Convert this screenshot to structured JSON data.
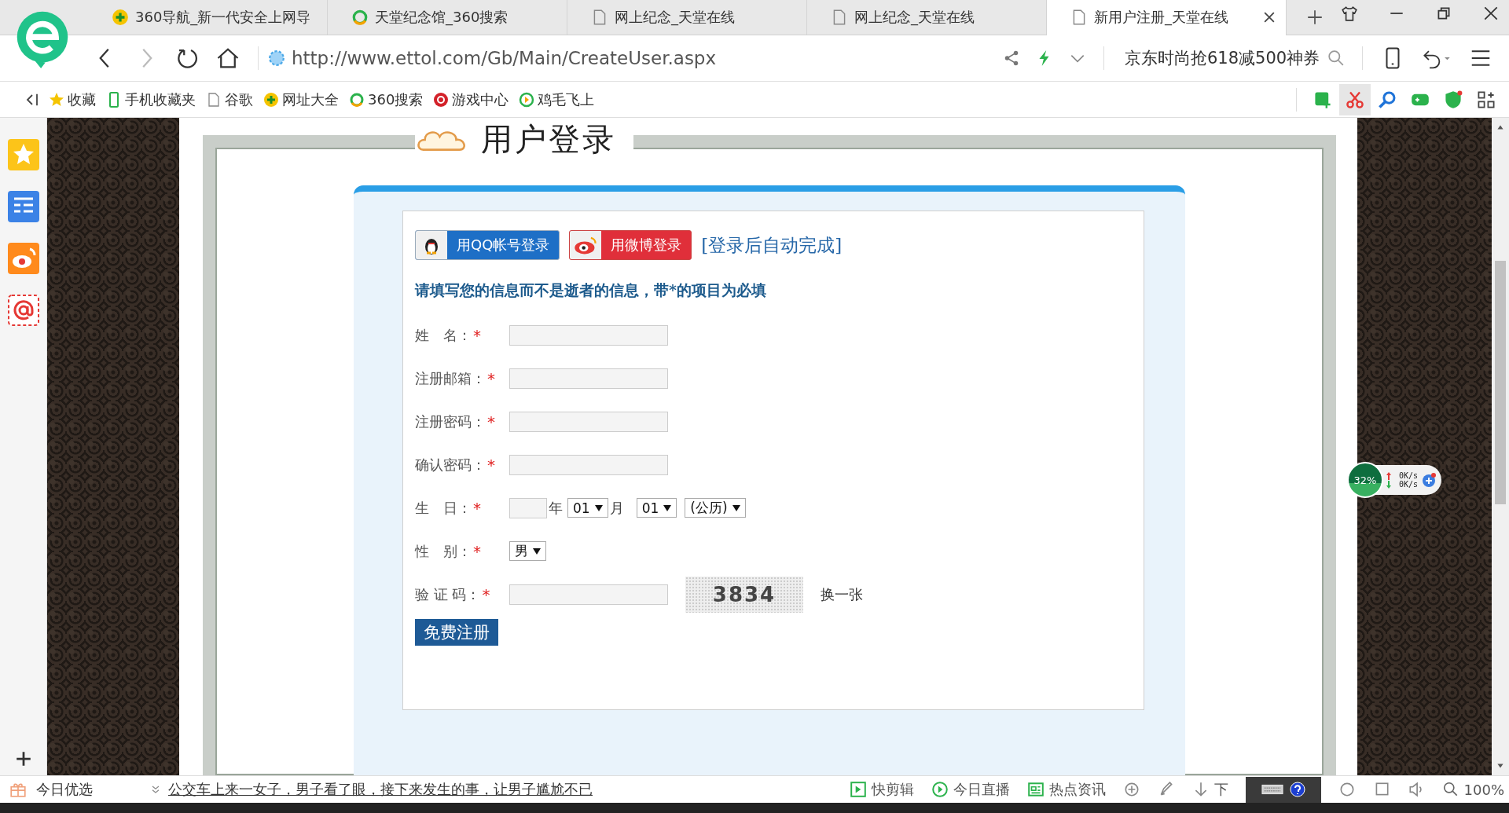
{
  "tabs": [
    {
      "label": "360导航_新一代安全上网导",
      "selected": false
    },
    {
      "label": "天堂纪念馆_360搜索",
      "selected": false
    },
    {
      "label": "网上纪念_天堂在线",
      "selected": false
    },
    {
      "label": "网上纪念_天堂在线",
      "selected": false
    },
    {
      "label": "新用户注册_天堂在线",
      "selected": true
    }
  ],
  "address": {
    "url": "http://www.ettol.com/Gb/Main/CreateUser.aspx",
    "search": "京东时尚抢618减500神券"
  },
  "bookmarks": [
    {
      "label": "收藏"
    },
    {
      "label": "手机收藏夹"
    },
    {
      "label": "谷歌"
    },
    {
      "label": "网址大全"
    },
    {
      "label": "360搜索"
    },
    {
      "label": "游戏中心"
    },
    {
      "label": "鸡毛飞上"
    }
  ],
  "page": {
    "title": "用户登录",
    "qq_login": "用QQ帐号登录",
    "weibo_login": "用微博登录",
    "auto_note": "[登录后自动完成]",
    "notice": "请填写您的信息而不是逝者的信息，带*的项目为必填",
    "fields": [
      {
        "kind": "text",
        "label": "姓　名：",
        "marker": "*"
      },
      {
        "kind": "text",
        "label": "注册邮箱：",
        "marker": "*"
      },
      {
        "kind": "text",
        "label": "注册密码：",
        "marker": "*"
      },
      {
        "kind": "text",
        "label": "确认密码：",
        "marker": "*"
      },
      {
        "kind": "date",
        "label": "生　日：",
        "marker": "*",
        "year_unit": "年",
        "month": "01",
        "month_unit": "月",
        "day": "01",
        "calendar": "(公历)"
      },
      {
        "kind": "select",
        "label": "性　别：",
        "marker": "*",
        "value": "男"
      },
      {
        "kind": "captcha",
        "label": "验 证 码：",
        "marker": "*",
        "code": "3834",
        "refresh": "换一张"
      }
    ],
    "submit": "免费注册"
  },
  "speed_widget": {
    "percent": "32%",
    "up": "0K/s",
    "down": "0K/s"
  },
  "status_bar": {
    "label": "今日优选",
    "news": "公交车上来一女子，男子看了眼，接下来发生的事，让男子尴尬不已",
    "items": [
      {
        "label": "快剪辑"
      },
      {
        "label": "今日直播"
      },
      {
        "label": "热点资讯"
      }
    ],
    "download": "下",
    "zoom": "100%"
  }
}
